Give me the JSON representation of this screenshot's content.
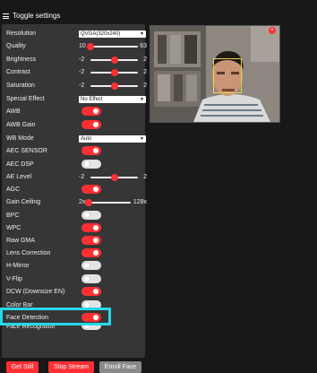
{
  "header": {
    "title": "Toggle settings"
  },
  "controls": {
    "resolution": {
      "label": "Resolution",
      "value": "QVGA(320x240)"
    },
    "quality": {
      "label": "Quality",
      "min": "10",
      "max": "63",
      "value": 10
    },
    "brightness": {
      "label": "Brightness",
      "min": "-2",
      "max": "2",
      "value": 0
    },
    "contrast": {
      "label": "Contrast",
      "min": "-2",
      "max": "2",
      "value": 0
    },
    "saturation": {
      "label": "Saturation",
      "min": "-2",
      "max": "2",
      "value": 0
    },
    "special_effect": {
      "label": "Special Effect",
      "value": "No Effect"
    },
    "awb": {
      "label": "AWB",
      "on": true
    },
    "awb_gain": {
      "label": "AWB Gain",
      "on": true
    },
    "wb_mode": {
      "label": "WB Mode",
      "value": "Auto"
    },
    "aec_sensor": {
      "label": "AEC SENSOR",
      "on": true
    },
    "aec_dsp": {
      "label": "AEC DSP",
      "on": false
    },
    "ae_level": {
      "label": "AE Level",
      "min": "-2",
      "max": "2",
      "value": 0
    },
    "agc": {
      "label": "AGC",
      "on": true
    },
    "gain_ceiling": {
      "label": "Gain Ceiling",
      "min": "2x",
      "max": "128x",
      "value": 0
    },
    "bpc": {
      "label": "BPC",
      "on": false
    },
    "wpc": {
      "label": "WPC",
      "on": true
    },
    "raw_gma": {
      "label": "Raw GMA",
      "on": true
    },
    "lens_correction": {
      "label": "Lens Correction",
      "on": true
    },
    "h_mirror": {
      "label": "H-Mirror",
      "on": false
    },
    "v_flip": {
      "label": "V-Flip",
      "on": false
    },
    "dcw": {
      "label": "DCW (Downsize EN)",
      "on": true
    },
    "color_bar": {
      "label": "Color Bar",
      "on": false
    },
    "face_detection": {
      "label": "Face Detection",
      "on": true
    },
    "face_recognition": {
      "label": "Face Recognition",
      "on": false
    }
  },
  "buttons": {
    "get_still": "Get Still",
    "stop_stream": "Stop Stream",
    "enroll_face": "Enroll Face"
  },
  "preview": {
    "close_symbol": "×"
  },
  "colors": {
    "accent": "#ff3034",
    "highlight": "#27d9e8",
    "panel": "#363636",
    "background": "#181818"
  }
}
